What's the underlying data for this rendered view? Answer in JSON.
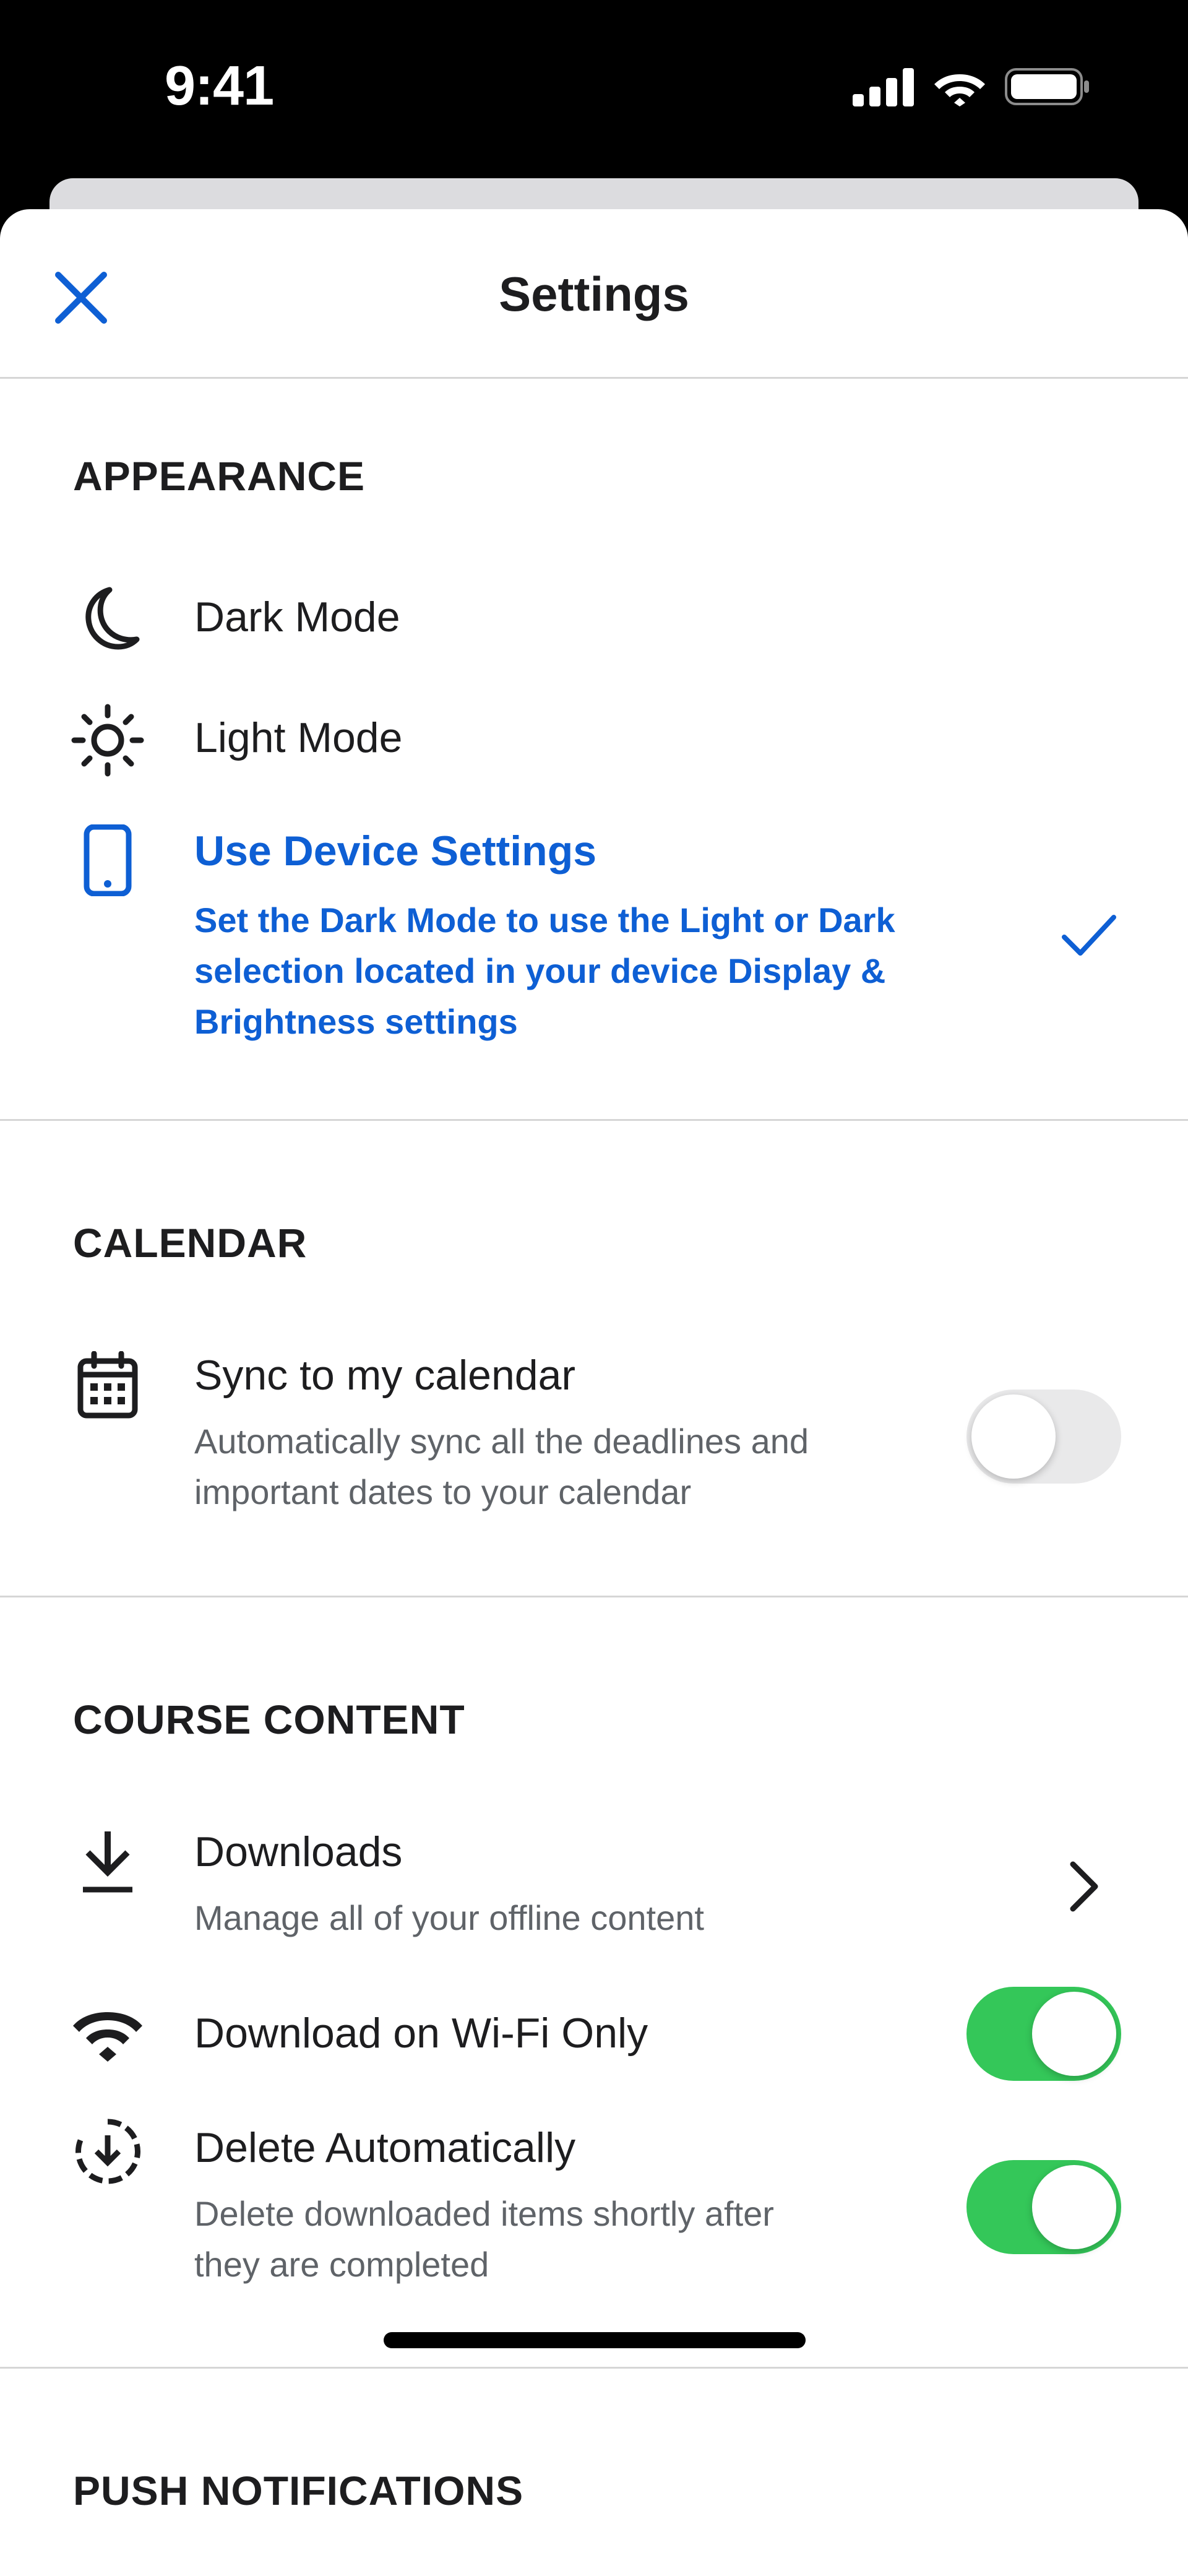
{
  "status_bar": {
    "time": "9:41"
  },
  "header": {
    "title": "Settings"
  },
  "sections": {
    "appearance": {
      "heading": "APPEARANCE",
      "dark_mode": "Dark Mode",
      "light_mode": "Light Mode",
      "device": {
        "title": "Use Device Settings",
        "line1": "Set the Dark Mode to use the Light or Dark",
        "line2": "selection located in your device Display &",
        "line3": "Brightness settings",
        "selected": true
      }
    },
    "calendar": {
      "heading": "CALENDAR",
      "sync": {
        "title": "Sync to my calendar",
        "line1": "Automatically sync all the deadlines and",
        "line2": "important dates to your calendar",
        "enabled": false
      }
    },
    "course_content": {
      "heading": "COURSE CONTENT",
      "downloads": {
        "title": "Downloads",
        "subtitle": "Manage all of your offline content"
      },
      "wifi_only": {
        "title": "Download on Wi-Fi Only",
        "enabled": true
      },
      "delete_auto": {
        "title": "Delete Automatically",
        "line1": "Delete downloaded items shortly after",
        "line2": "they are completed",
        "enabled": true
      }
    },
    "push_notifications": {
      "heading": "PUSH NOTIFICATIONS"
    }
  },
  "colors": {
    "accent": "#0e5fd4",
    "toggle_on": "#34c759",
    "toggle_off": "#e9e9ea",
    "text_primary": "#1d1d1f",
    "text_secondary": "#5f6368"
  },
  "icons": {
    "close": "close-icon",
    "dark_mode": "moon-icon",
    "light_mode": "sun-icon",
    "device": "phone-icon",
    "calendar": "calendar-icon",
    "downloads": "download-icon",
    "wifi": "wifi-icon",
    "delete": "download-timer-icon",
    "check": "checkmark-icon",
    "chevron": "chevron-right-icon"
  }
}
